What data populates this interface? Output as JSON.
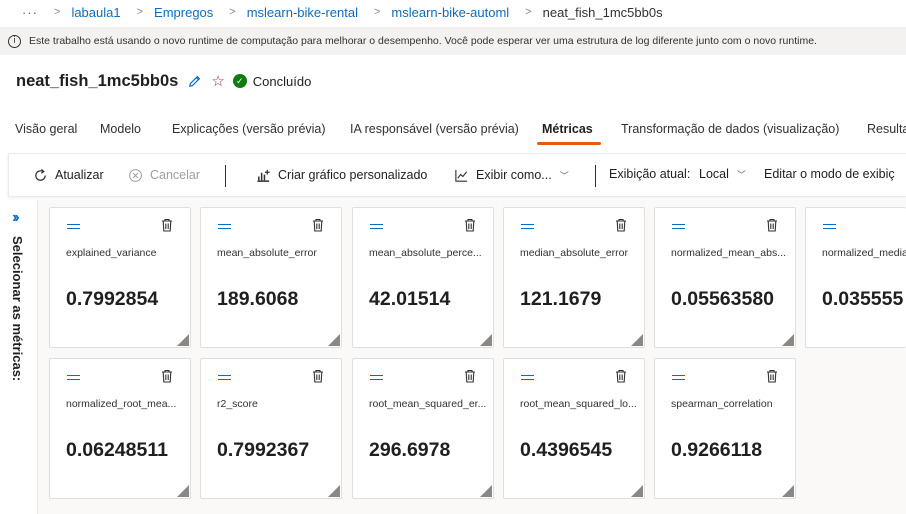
{
  "breadcrumb": {
    "more": "···",
    "items": [
      "labaula1",
      "Empregos",
      "mslearn-bike-rental",
      "mslearn-bike-automl",
      "neat_fish_1mc5bb0s"
    ]
  },
  "info_bar": {
    "text": "Este trabalho está usando o novo runtime de computação para melhorar o desempenho. Você pode esperar ver uma estrutura de log diferente junto com o novo runtime."
  },
  "run": {
    "title": "neat_fish_1mc5bb0s",
    "status": "Concluído",
    "status_color": "#107c10"
  },
  "tabs": [
    {
      "label": "Visão geral"
    },
    {
      "label": "Modelo"
    },
    {
      "label": "Explicações (versão prévia)"
    },
    {
      "label": "IA responsável (versão prévia)"
    },
    {
      "label": "Métricas",
      "active": true
    },
    {
      "label": "Transformação de dados (visualização)"
    },
    {
      "label": "Resulta"
    }
  ],
  "toolbar": {
    "refresh": "Atualizar",
    "cancel": "Cancelar",
    "custom_chart": "Criar gráfico personalizado",
    "view_as": "Exibir como...",
    "current_view_label": "Exibição atual:",
    "current_view_value": "Local",
    "edit_mode": "Editar o modo de exibiç"
  },
  "side_panel": {
    "label": "Selecionar as métricas:"
  },
  "metrics": [
    {
      "name": "explained_variance",
      "value": "0.7992854"
    },
    {
      "name": "mean_absolute_error",
      "value": "189.6068"
    },
    {
      "name": "mean_absolute_perce...",
      "value": "42.01514"
    },
    {
      "name": "median_absolute_error",
      "value": "121.1679"
    },
    {
      "name": "normalized_mean_abs...",
      "value": "0.05563580"
    },
    {
      "name": "normalized_media",
      "value": "0.035555"
    },
    {
      "name": "normalized_root_mea...",
      "value": "0.06248511"
    },
    {
      "name": "r2_score",
      "value": "0.7992367"
    },
    {
      "name": "root_mean_squared_er...",
      "value": "296.6978"
    },
    {
      "name": "root_mean_squared_lo...",
      "value": "0.4396545"
    },
    {
      "name": "spearman_correlation",
      "value": "0.9266118"
    }
  ],
  "colors": {
    "link": "#0f6cbd",
    "tab_underline": "#e8590c",
    "star": "#a4262c"
  }
}
